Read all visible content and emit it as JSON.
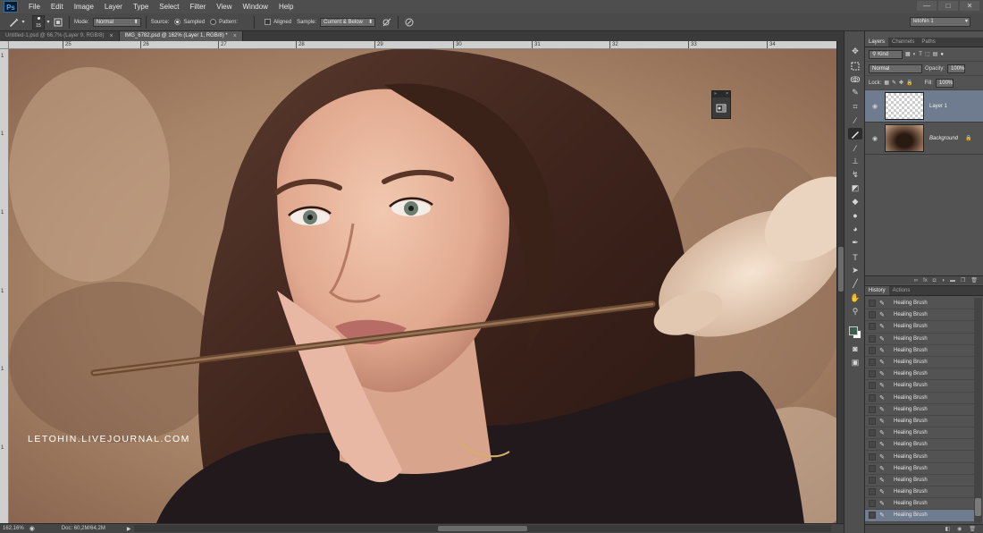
{
  "app": {
    "logo": "Ps",
    "workspace": "letohin 1"
  },
  "menu": [
    "File",
    "Edit",
    "Image",
    "Layer",
    "Type",
    "Select",
    "Filter",
    "View",
    "Window",
    "Help"
  ],
  "window_controls": [
    "—",
    "□",
    "✕"
  ],
  "options": {
    "brush_size": "15",
    "mode_label": "Mode:",
    "mode_value": "Normal",
    "source_label": "Source:",
    "sampled_label": "Sampled",
    "pattern_label": "Pattern:",
    "aligned_label": "Aligned",
    "sample_label": "Sample:",
    "sample_value": "Current & Below"
  },
  "tabs": [
    {
      "label": "Untitled-1.psd @ 66,7% (Layer 9, RGB/8)",
      "close": "×"
    },
    {
      "label": "IMG_6782.psd @ 162% (Layer 1, RGB/8) *",
      "close": "×"
    }
  ],
  "ruler_top": [
    "25",
    "26",
    "27",
    "28",
    "29",
    "30",
    "31",
    "32",
    "33",
    "34"
  ],
  "ruler_left": [
    "1",
    "1",
    "1",
    "1",
    "1",
    "1",
    "1",
    "1",
    "1"
  ],
  "watermark": "LETOHIN.LIVEJOURNAL.COM",
  "status": {
    "zoom": "162,16%",
    "doc": "Doc: 60,2M/64,2M"
  },
  "float_panel": {
    "icon": "clone-source-icon"
  },
  "colors": {
    "foreground": "#3a5e4f",
    "background": "#ffffff",
    "selection": "#6f7c8f"
  },
  "layers_panel": {
    "tabs": [
      "Layers",
      "Channels",
      "Paths"
    ],
    "kind_label": "Kind",
    "blend_mode": "Normal",
    "opacity_label": "Opacity:",
    "opacity_value": "100%",
    "lock_label": "Lock:",
    "fill_label": "Fill:",
    "fill_value": "100%",
    "layers": [
      {
        "name": "Layer 1",
        "selected": true
      },
      {
        "name": "Background",
        "selected": false
      }
    ]
  },
  "history_panel": {
    "tabs": [
      "History",
      "Actions"
    ],
    "items": [
      "Healing Brush",
      "Healing Brush",
      "Healing Brush",
      "Healing Brush",
      "Healing Brush",
      "Healing Brush",
      "Healing Brush",
      "Healing Brush",
      "Healing Brush",
      "Healing Brush",
      "Healing Brush",
      "Healing Brush",
      "Healing Brush",
      "Healing Brush",
      "Healing Brush",
      "Healing Brush",
      "Healing Brush",
      "Healing Brush",
      "Healing Brush"
    ]
  }
}
